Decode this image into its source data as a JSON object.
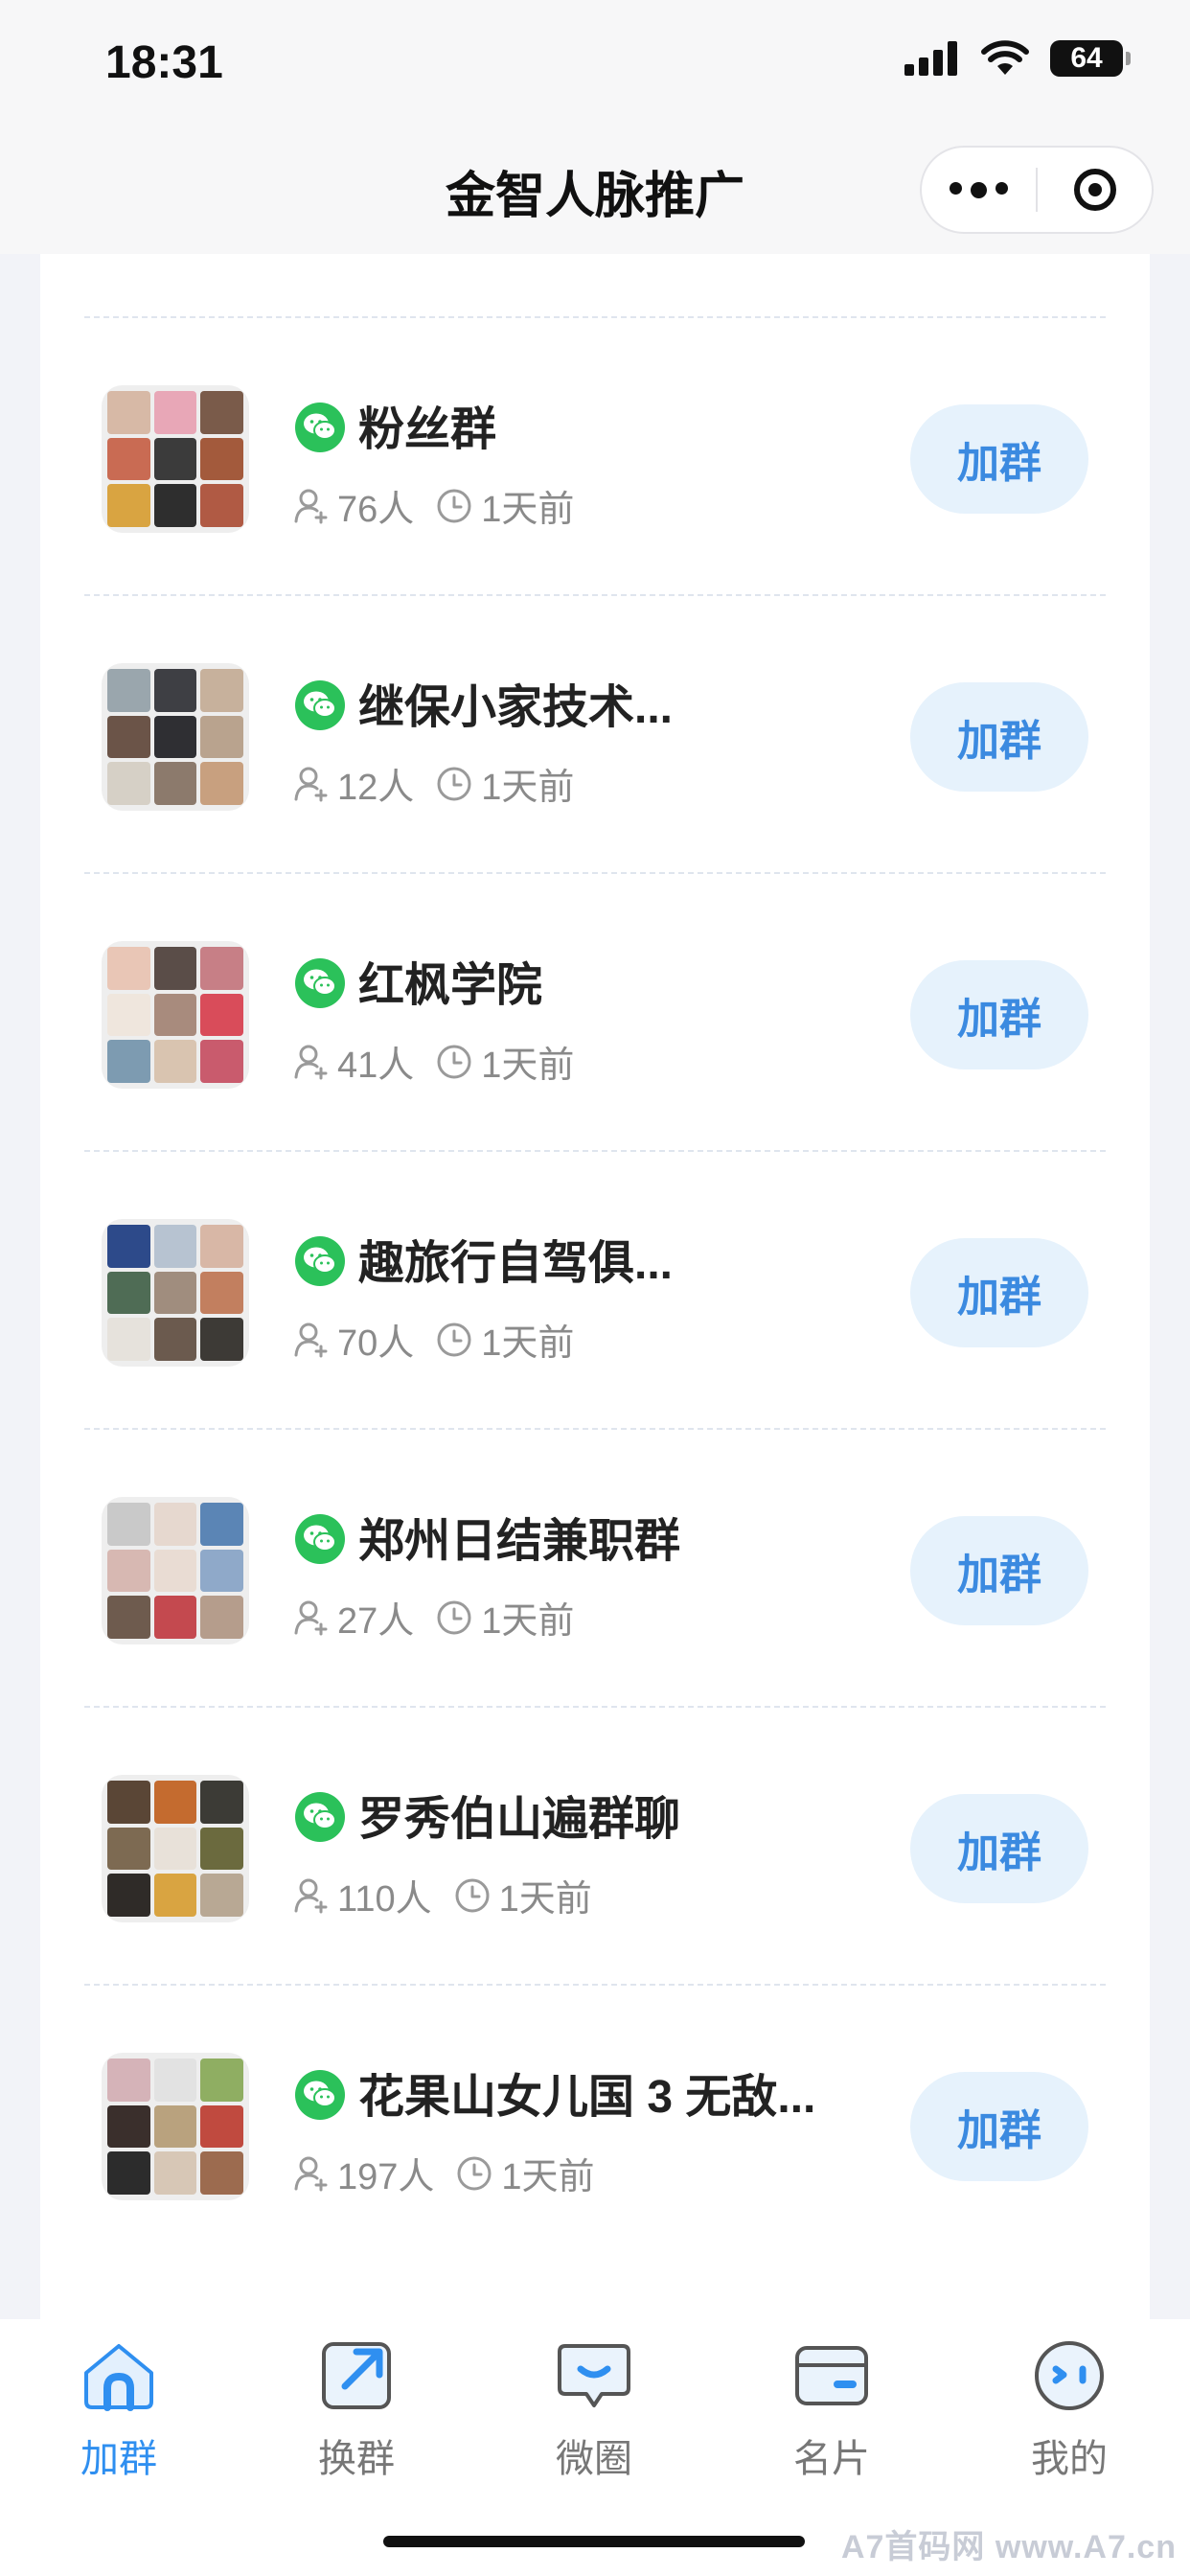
{
  "status_bar": {
    "time": "18:31",
    "battery": "64"
  },
  "nav": {
    "title": "金智人脉推广"
  },
  "groups": [
    {
      "name": "粉丝群",
      "members": "76人",
      "time": "1天前",
      "button": "加群"
    },
    {
      "name": "继保小家技术...",
      "members": "12人",
      "time": "1天前",
      "button": "加群"
    },
    {
      "name": "红枫学院",
      "members": "41人",
      "time": "1天前",
      "button": "加群"
    },
    {
      "name": "趣旅行自驾俱...",
      "members": "70人",
      "time": "1天前",
      "button": "加群"
    },
    {
      "name": "郑州日结兼职群",
      "members": "27人",
      "time": "1天前",
      "button": "加群"
    },
    {
      "name": "罗秀伯山遍群聊",
      "members": "110人",
      "time": "1天前",
      "button": "加群"
    },
    {
      "name": "花果山女儿国 3 无敌...",
      "members": "197人",
      "time": "1天前",
      "button": "加群"
    }
  ],
  "tabs": [
    {
      "label": "加群",
      "icon": "home-icon",
      "active": true
    },
    {
      "label": "换群",
      "icon": "swap-icon",
      "active": false
    },
    {
      "label": "微圈",
      "icon": "chat-icon",
      "active": false
    },
    {
      "label": "名片",
      "icon": "card-icon",
      "active": false
    },
    {
      "label": "我的",
      "icon": "profile-icon",
      "active": false
    }
  ],
  "watermark": "A7首码网  www.A7.cn",
  "colors": {
    "accent": "#2f8ff0",
    "button_bg": "#e6f2fc",
    "wechat_green": "#2bc15a"
  }
}
